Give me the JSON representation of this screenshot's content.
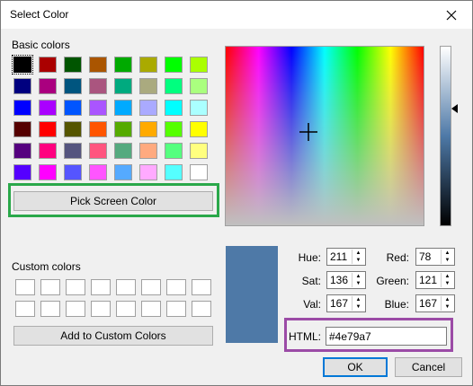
{
  "window": {
    "title": "Select Color"
  },
  "labels": {
    "basic_colors": "Basic colors",
    "custom_colors": "Custom colors"
  },
  "buttons": {
    "pick_screen_color": "Pick Screen Color",
    "add_to_custom": "Add to Custom Colors",
    "ok": "OK",
    "cancel": "Cancel"
  },
  "basic_colors": [
    [
      "#000000",
      "#aa0000",
      "#005500",
      "#aa5500",
      "#00aa00",
      "#aaaa00",
      "#00ff00",
      "#aaff00"
    ],
    [
      "#00007f",
      "#aa007f",
      "#00557f",
      "#aa557f",
      "#00aa7f",
      "#aaaa7f",
      "#00ff7f",
      "#aaff7f"
    ],
    [
      "#0000ff",
      "#aa00ff",
      "#0055ff",
      "#aa55ff",
      "#00aaff",
      "#aaaaff",
      "#00ffff",
      "#aaffff"
    ],
    [
      "#550000",
      "#ff0000",
      "#555500",
      "#ff5500",
      "#55aa00",
      "#ffaa00",
      "#55ff00",
      "#ffff00"
    ],
    [
      "#55007f",
      "#ff007f",
      "#55557f",
      "#ff557f",
      "#55aa7f",
      "#ffaa7f",
      "#55ff7f",
      "#ffff7f"
    ],
    [
      "#5500ff",
      "#ff00ff",
      "#5555ff",
      "#ff55ff",
      "#55aaff",
      "#ffaaff",
      "#55ffff",
      "#ffffff"
    ]
  ],
  "selected_basic_color_index": 0,
  "fields": {
    "hue_label": "Hue:",
    "hue": "211",
    "sat_label": "Sat:",
    "sat": "136",
    "val_label": "Val:",
    "val": "167",
    "red_label": "Red:",
    "red": "78",
    "green_label": "Green:",
    "green": "121",
    "blue_label": "Blue:",
    "blue": "167",
    "html_label": "HTML:",
    "html": "#4e79a7"
  },
  "current_color": "#4e79a7",
  "highlight_colors": {
    "pick_screen": "#2aa84a",
    "html_field": "#9b4ba6"
  }
}
